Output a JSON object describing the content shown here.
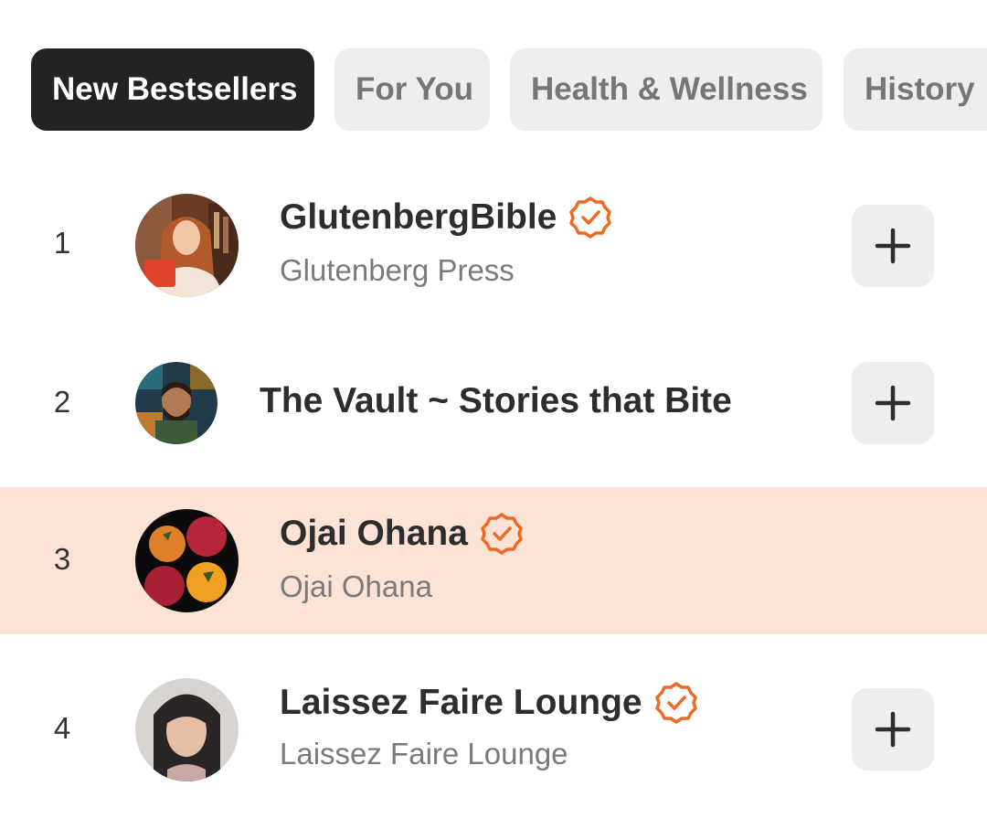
{
  "tabs": [
    {
      "label": "New Bestsellers",
      "active": true
    },
    {
      "label": "For You",
      "active": false
    },
    {
      "label": "Health & Wellness",
      "active": false
    },
    {
      "label": "History",
      "active": false
    }
  ],
  "list": [
    {
      "rank": "1",
      "title": "GlutenbergBible",
      "subtitle": "Glutenberg Press",
      "verified": true,
      "add_button": true
    },
    {
      "rank": "2",
      "title": "The Vault ~ Stories that Bite",
      "subtitle": "",
      "verified": false,
      "add_button": true
    },
    {
      "rank": "3",
      "title": "Ojai Ohana",
      "subtitle": "Ojai Ohana",
      "verified": true,
      "add_button": false,
      "highlighted": true
    },
    {
      "rank": "4",
      "title": "Laissez Faire Lounge",
      "subtitle": "Laissez Faire Lounge",
      "verified": true,
      "add_button": true
    }
  ],
  "colors": {
    "accent": "#ee6a24",
    "active_tab_bg": "#232323",
    "highlight_row": "#fde2d6",
    "button_bg": "#eeeeee"
  },
  "icons": {
    "verified": "verified-badge-icon",
    "add": "plus-icon"
  }
}
